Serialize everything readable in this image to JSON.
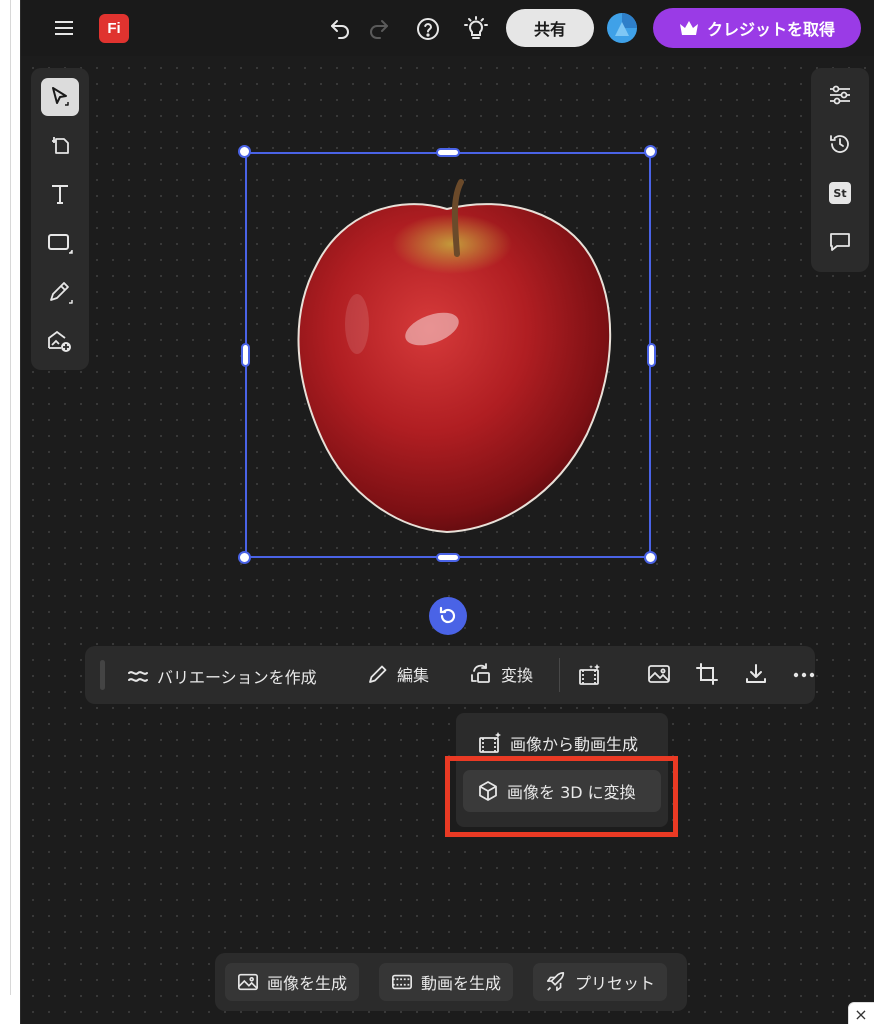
{
  "header": {
    "logo_text": "Fi",
    "share_label": "共有",
    "credits_label": "クレジットを取得",
    "colors": {
      "logo_red": "#e0332f",
      "credits_purple": "#9a3be6",
      "share_bg": "#e6e6e6"
    }
  },
  "toolbar": {
    "variation_label": "バリエーションを作成",
    "edit_label": "編集",
    "transform_label": "変換"
  },
  "dropdown": {
    "items": [
      {
        "label": "画像から動画生成"
      },
      {
        "label": "画像を 3D に変換"
      }
    ],
    "highlight_color": "#ea3a24"
  },
  "bottom": {
    "generate_image_label": "画像を生成",
    "generate_video_label": "動画を生成",
    "preset_label": "プリセット"
  },
  "icons": {
    "left_tools": [
      "select-icon",
      "frame-icon",
      "text-icon",
      "rectangle-icon",
      "pen-icon",
      "add-image-icon"
    ],
    "right_tools": [
      "adjust-icon",
      "history-icon",
      "stock-icon",
      "comment-icon"
    ]
  },
  "stock_badge": "St",
  "corner_close": "×",
  "accent": "#4a63e6"
}
